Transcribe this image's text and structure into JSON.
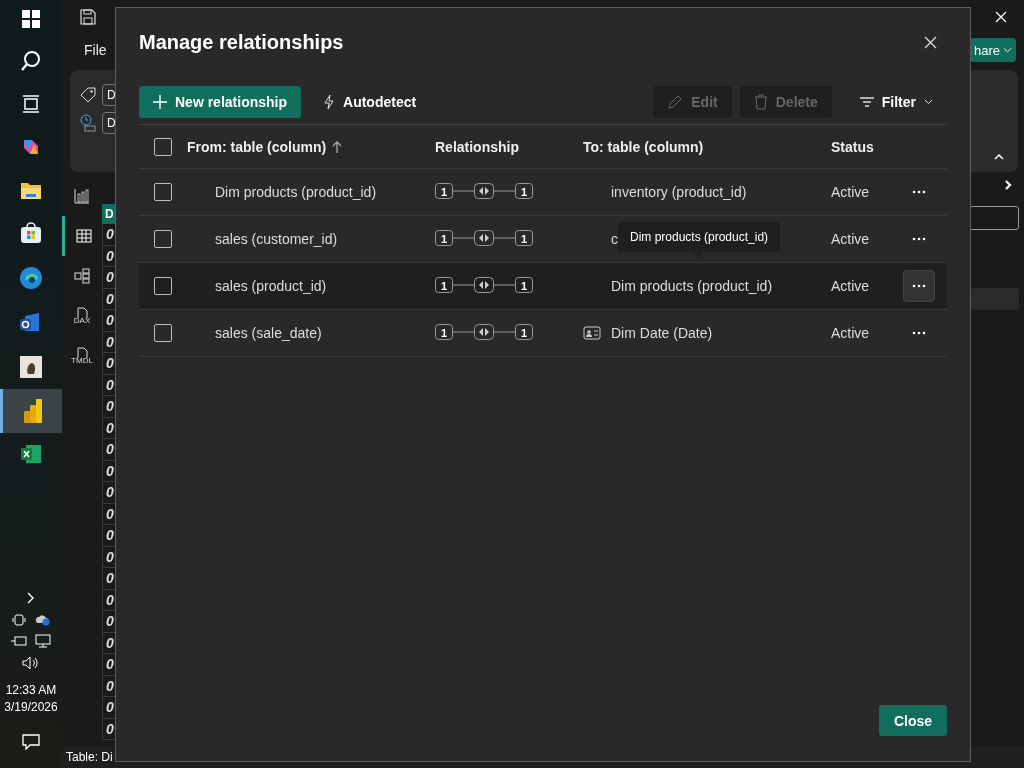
{
  "taskbar": {
    "time": "12:33 AM",
    "date": "3/19/2026"
  },
  "app": {
    "menu": [
      "File"
    ],
    "share": {
      "label": "hare"
    },
    "ribbon_fields": [
      {
        "value": "D"
      },
      {
        "value": "D"
      }
    ],
    "nav": [
      {
        "kind": "report",
        "selected": false
      },
      {
        "kind": "table",
        "selected": true
      },
      {
        "kind": "model",
        "selected": false
      },
      {
        "kind": "dax",
        "label": "DAX",
        "selected": false
      },
      {
        "kind": "tmdl",
        "label": "TMDL",
        "selected": false
      }
    ],
    "grid": {
      "header": "D",
      "cells": [
        "0",
        "0",
        "0",
        "0",
        "0",
        "0",
        "0",
        "0",
        "0",
        "0",
        "0",
        "0",
        "0",
        "0",
        "0",
        "0",
        "0",
        "0",
        "0",
        "0",
        "0",
        "0",
        "0",
        "0"
      ]
    },
    "status_bar": "Table: Di"
  },
  "dialog": {
    "title": "Manage relationships",
    "toolbar": [
      {
        "kind": "primary",
        "label": "New relationship",
        "disabled": false
      },
      {
        "kind": "auto",
        "label": "Autodetect",
        "disabled": false
      },
      {
        "kind": "edit",
        "label": "Edit",
        "disabled": true
      },
      {
        "kind": "delete",
        "label": "Delete",
        "disabled": true
      },
      {
        "kind": "filter",
        "label": "Filter",
        "disabled": false
      }
    ],
    "select_all": {
      "checked": false
    },
    "columns": [
      "From: table (column)",
      "Relationship",
      "To: table (column)",
      "Status"
    ],
    "rows": [
      {
        "from": "Dim products (product_id)",
        "from_card": "1",
        "to_card": "1",
        "bidirectional": true,
        "to": "inventory (product_id)",
        "date_table": false,
        "status": "Active",
        "checked": false,
        "highlighted": false
      },
      {
        "from": "sales (customer_id)",
        "from_card": "1",
        "to_card": "1",
        "bidirectional": true,
        "to": "c",
        "date_table": false,
        "status": "Active",
        "checked": false,
        "highlighted": false
      },
      {
        "from": "sales (product_id)",
        "from_card": "1",
        "to_card": "1",
        "bidirectional": true,
        "to": "Dim products (product_id)",
        "date_table": false,
        "status": "Active",
        "checked": false,
        "highlighted": true
      },
      {
        "from": "sales (sale_date)",
        "from_card": "1",
        "to_card": "1",
        "bidirectional": true,
        "to": "Dim Date (Date)",
        "date_table": true,
        "status": "Active",
        "checked": false,
        "highlighted": false
      }
    ],
    "tooltip": "Dim products (product_id)",
    "close": "Close"
  }
}
